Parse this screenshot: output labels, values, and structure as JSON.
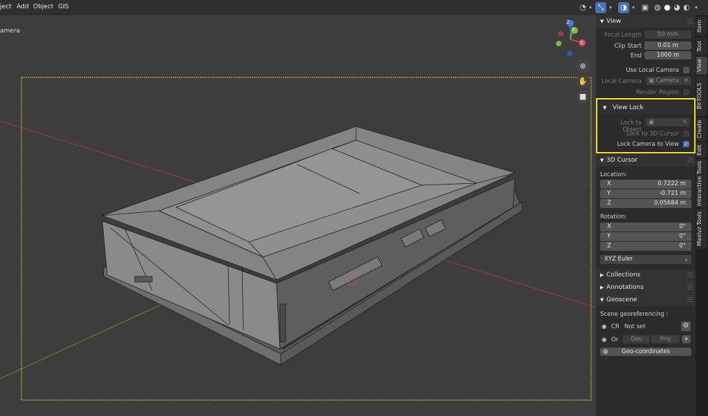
{
  "menu": {
    "items": [
      "ject",
      "Add",
      "Object",
      "GIS"
    ]
  },
  "viewport": {
    "camera_label": "amera",
    "nav_icons": [
      "zoom-icon",
      "pan-hand-icon",
      "camera-view-icon"
    ],
    "gizmo_axes": [
      "Z",
      "Y",
      "X"
    ]
  },
  "tabs": [
    "Item",
    "Tool",
    "View",
    "BY-TOOLS",
    "Create",
    "Edit",
    "Interactive Tools",
    "Maxivz Tools"
  ],
  "active_tab": "View",
  "view": {
    "header": "View",
    "focal_length_label": "Focal Length",
    "focal_length": "50 mm",
    "clip_start_label": "Clip Start",
    "clip_start": "0.01 m",
    "end_label": "End",
    "end": "1000 m",
    "use_local_camera": "Use Local Camera",
    "local_camera_label": "Local Camera",
    "local_camera_value": "Camera",
    "render_region": "Render Region"
  },
  "view_lock": {
    "header": "View Lock",
    "lock_to_object": "Lock to Object",
    "lock_to_3d_cursor": "Lock to 3D Cursor",
    "lock_camera_to_view": "Lock Camera to View",
    "lock_camera_to_view_checked": true,
    "highlight_color": "#f5e51d"
  },
  "cursor": {
    "header": "3D Cursor",
    "location_label": "Location:",
    "location": [
      {
        "axis": "X",
        "value": "0.7222 m"
      },
      {
        "axis": "Y",
        "value": "-0.721 m"
      },
      {
        "axis": "Z",
        "value": "0.05684 m"
      }
    ],
    "rotation_label": "Rotation:",
    "rotation": [
      {
        "axis": "X",
        "value": "0°"
      },
      {
        "axis": "Y",
        "value": "0°"
      },
      {
        "axis": "Z",
        "value": "0°"
      }
    ],
    "rotation_mode": "XYZ Euler"
  },
  "collections": {
    "header": "Collections"
  },
  "annotations": {
    "header": "Annotations"
  },
  "geoscene": {
    "header": "Geoscene",
    "scene_label": "Scene georeferencing :",
    "crs_label": "CR",
    "crs_value": "Not set",
    "or_label": "Or",
    "geo_button": "Geo",
    "proj_button": "Proj",
    "geo_coordinates_button": "Geo-coordinates"
  },
  "colors": {
    "accent": "#4772b3",
    "x_axis": "#e04a55",
    "y_axis": "#7bbd3a",
    "z_axis": "#3c7be0",
    "camera_frame": "#d8cc3a"
  }
}
